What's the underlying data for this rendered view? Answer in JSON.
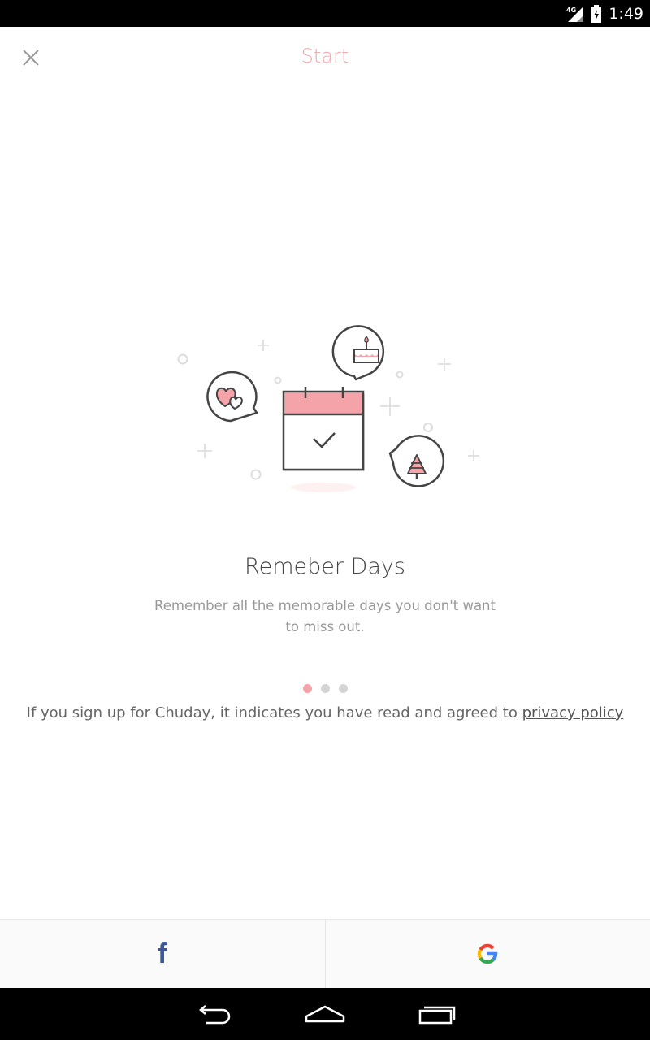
{
  "status_bar": {
    "network": "4G",
    "time": "1:49"
  },
  "header": {
    "title": "Start",
    "close_icon": "close-icon"
  },
  "slide": {
    "title": "Remeber Days",
    "description": "Remember all the memorable days you don't want to miss out.",
    "illustration_icons": [
      "calendar-check-icon",
      "hearts-bubble-icon",
      "birthday-cake-bubble-icon",
      "christmas-tree-bubble-icon"
    ]
  },
  "pagination": {
    "total": 3,
    "active_index": 0
  },
  "agreement": {
    "text": "If you sign up for Chuday, it indicates you have read and agreed to ",
    "link": "privacy policy"
  },
  "login": {
    "facebook_glyph": "f",
    "google_icon": "google-icon"
  },
  "colors": {
    "accent": "#f4a3a8",
    "facebook": "#3b5998",
    "line": "#444444"
  }
}
